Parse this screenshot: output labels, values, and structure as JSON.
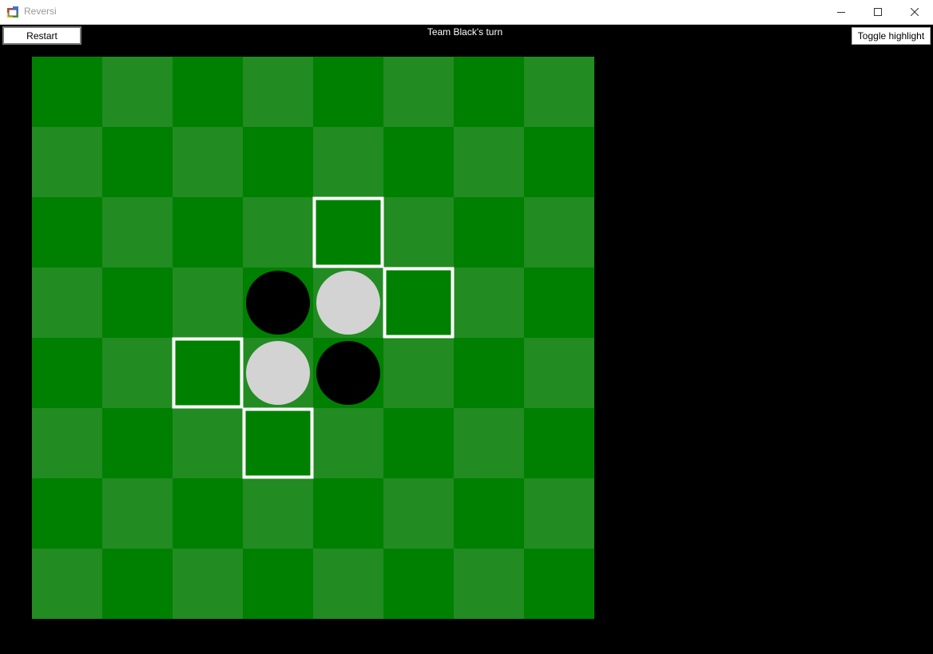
{
  "window": {
    "title": "Reversi"
  },
  "toolbar": {
    "restart_label": "Restart",
    "toggle_highlight_label": "Toggle highlight"
  },
  "status": {
    "turn_text": "Team Black's turn"
  },
  "board": {
    "rows": 8,
    "cols": 8,
    "colors": {
      "dark_square": "#008000",
      "light_square": "#228b22",
      "black_piece": "#000000",
      "white_piece": "#d3d3d3",
      "highlight": "#ffffff"
    },
    "pieces": [
      {
        "row": 3,
        "col": 3,
        "color": "black"
      },
      {
        "row": 3,
        "col": 4,
        "color": "white"
      },
      {
        "row": 4,
        "col": 3,
        "color": "white"
      },
      {
        "row": 4,
        "col": 4,
        "color": "black"
      }
    ],
    "valid_moves": [
      {
        "row": 2,
        "col": 4
      },
      {
        "row": 3,
        "col": 5
      },
      {
        "row": 4,
        "col": 2
      },
      {
        "row": 5,
        "col": 3
      }
    ]
  }
}
